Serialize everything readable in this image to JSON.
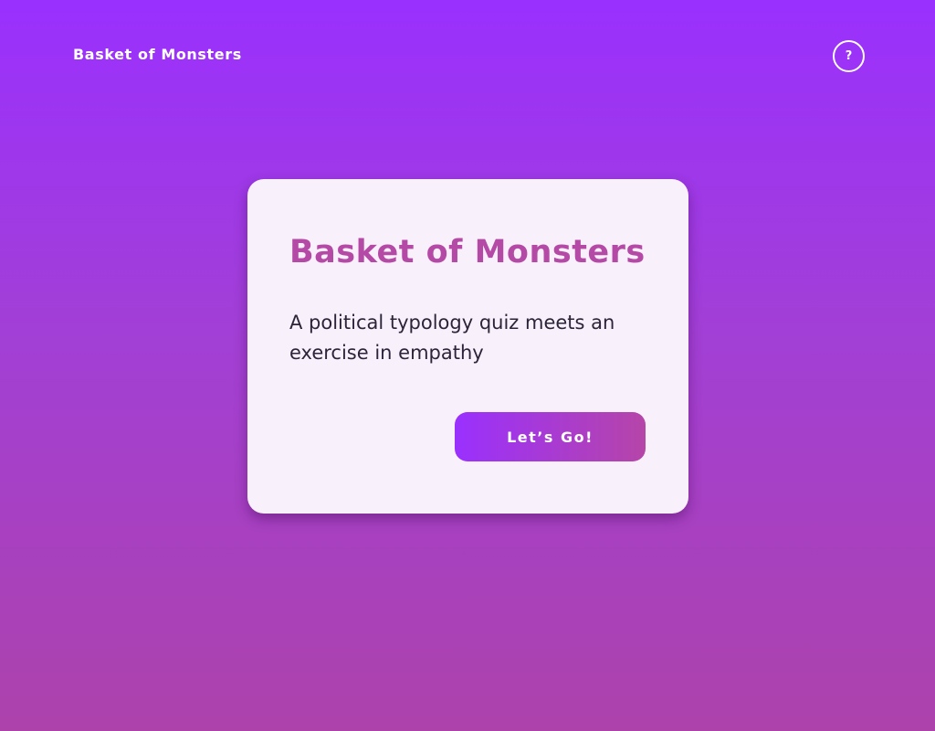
{
  "header": {
    "title": "Basket of Monsters",
    "help_label": "?"
  },
  "card": {
    "title": "Basket of Monsters",
    "subtitle": "A political typology quiz meets an exercise in empathy",
    "cta_label": "Let’s Go!"
  },
  "colors": {
    "background_top": "#9a30fe",
    "background_bottom": "#ad42ab",
    "card_background": "#f8f1fb",
    "title_accent": "#b54aa6",
    "body_text": "#2c2438",
    "button_gradient_start": "#9a30fe",
    "button_gradient_end": "#b645a8"
  },
  "icons": {
    "help": "help-icon"
  }
}
